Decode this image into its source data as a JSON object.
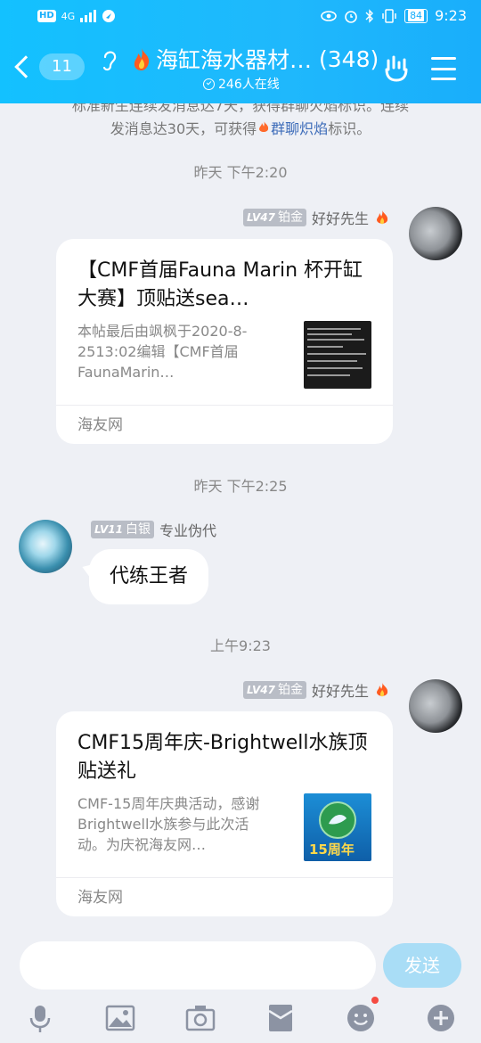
{
  "status": {
    "network": "4G",
    "battery": "84",
    "time": "9:23"
  },
  "header": {
    "back_count": "11",
    "title": "海缸海水器材…",
    "member_count": "(348)",
    "online": "246人在线"
  },
  "chat": {
    "notice_line1": "标准新生连续发消息达7天，获得群聊火焰标识。连续",
    "notice_line2": "发消息达30天，可获得",
    "notice_link": "群聊炽焰",
    "notice_tail": "标识。",
    "messages": [
      {
        "time": "昨天 下午2:20",
        "level": "LV47",
        "rank": "铂金",
        "sender": "好好先生",
        "card_title": "【CMF首届Fauna Marin 杯开缸大赛】顶贴送sea…",
        "card_desc": "本帖最后由飒枫于2020-8-2513:02编辑【CMF首届FaunaMarin…",
        "card_source": "海友网"
      },
      {
        "time": "昨天 下午2:25",
        "level": "LV11",
        "rank": "白银",
        "sender": "专业伪代",
        "text": "代练王者"
      },
      {
        "time": "上午9:23",
        "level": "LV47",
        "rank": "铂金",
        "sender": "好好先生",
        "card_title": "CMF15周年庆-Brightwell水族顶贴送礼",
        "card_desc": "CMF-15周年庆典活动，感谢Brightwell水族参与此次活动。为庆祝海友网…",
        "card_source": "海友网",
        "thumb_text": "15周年"
      }
    ]
  },
  "input": {
    "placeholder": "",
    "send_label": "发送"
  },
  "toolbar": [
    "mic-icon",
    "image-icon",
    "camera-icon",
    "red-packet-icon",
    "emoji-icon",
    "plus-icon"
  ],
  "colors": {
    "header": "#19aefb",
    "send_disabled": "#a9ddf6",
    "link": "#3d6cb9",
    "badge_dot": "#f54b42"
  }
}
